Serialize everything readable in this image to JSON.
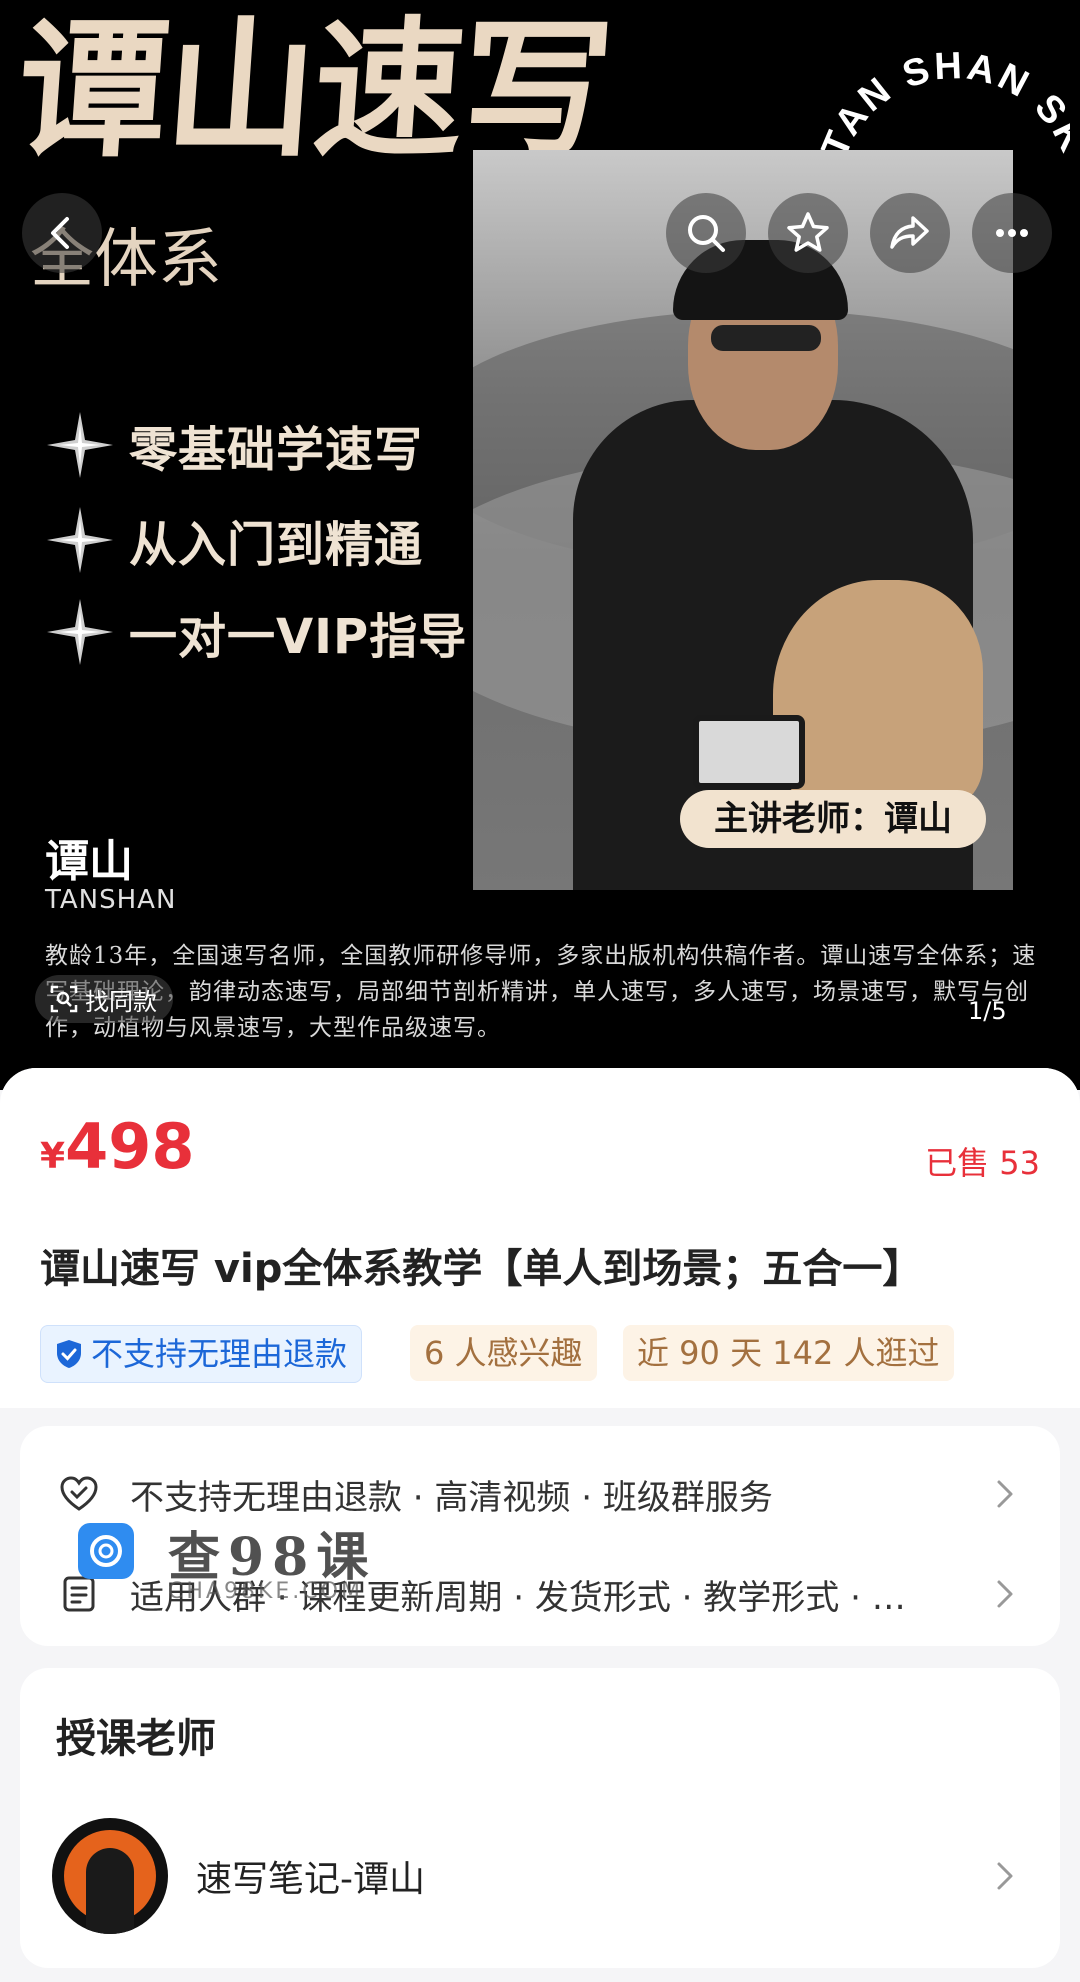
{
  "hero": {
    "title": "谭山速写",
    "subtitle": "全体系",
    "brand_arc": "TAN SHAN SKETCH",
    "features": [
      "零基础学速写",
      "从入门到精通",
      "一对一VIP指导"
    ],
    "name_cn": "谭山",
    "name_en": "TANSHAN",
    "teacher_pill": "主讲老师：谭山",
    "bio": "教龄13年，全国速写名师，全国教师研修导师，多家出版机构供稿作者。谭山速写全体系；速写基础理论，韵律动态速写，局部细节剖析精讲，单人速写，多人速写，场景速写，默写与创作，动植物与风景速写，大型作品级速写。",
    "find_similar": "找同款",
    "page_indicator": "1/5"
  },
  "icons": {
    "back": "chevron-left-icon",
    "search": "search-icon",
    "favorite": "star-icon",
    "share": "share-icon",
    "more": "more-icon"
  },
  "product": {
    "currency": "¥",
    "price": "498",
    "sold": "已售 53",
    "title": "谭山速写 vip全体系教学【单人到场景；五合一】",
    "tags": [
      "不支持无理由退款",
      "6 人感兴趣",
      "近 90 天 142 人逛过"
    ]
  },
  "services": {
    "row1": "不支持无理由退款 · 高清视频 · 班级群服务",
    "row2": "适用人群 · 课程更新周期 · 发货形式 · 教学形式 · …"
  },
  "teacher": {
    "heading": "授课老师",
    "name": "速写笔记-谭山"
  },
  "watermark": {
    "text": "查98课",
    "url": "CHA98KE.COM"
  },
  "colors": {
    "accent_red": "#e8303a",
    "tag_blue": "#1c67d8",
    "tag_brown": "#a3703f",
    "title_cream": "#ead8c2"
  }
}
